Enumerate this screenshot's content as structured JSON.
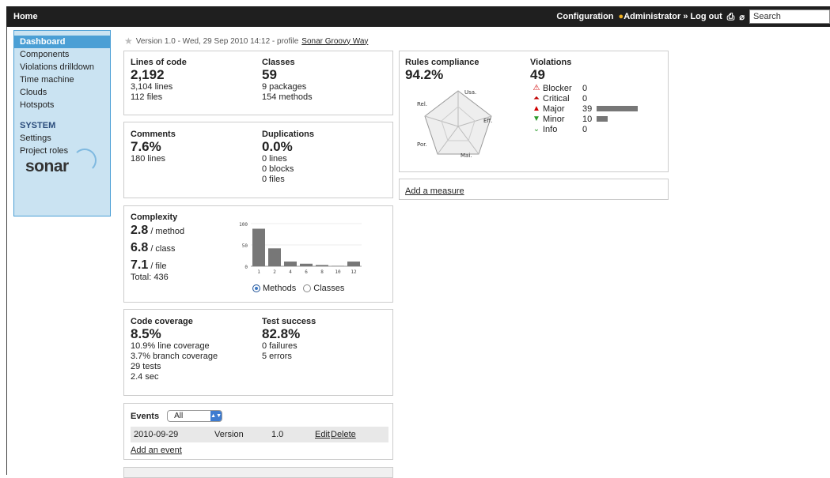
{
  "topbar": {
    "home": "Home",
    "configuration": "Configuration",
    "user": "Administrator",
    "separator": "»",
    "logout": "Log out",
    "search_value": "Search"
  },
  "sidebar": {
    "items": [
      "Dashboard",
      "Components",
      "Violations drilldown",
      "Time machine",
      "Clouds",
      "Hotspots"
    ],
    "system_header": "SYSTEM",
    "system_items": [
      "Settings",
      "Project roles"
    ],
    "logo": "sonar"
  },
  "version": {
    "text": "Version 1.0 - Wed, 29 Sep 2010 14:12 - profile",
    "profile": "Sonar Groovy Way"
  },
  "lines": {
    "label": "Lines of code",
    "value": "2,192",
    "lines": "3,104 lines",
    "files": "112 files"
  },
  "classes": {
    "label": "Classes",
    "value": "59",
    "packages": "9 packages",
    "methods": "154 methods"
  },
  "comments": {
    "label": "Comments",
    "value": "7.6%",
    "lines": "180 lines"
  },
  "duplications": {
    "label": "Duplications",
    "value": "0.0%",
    "lines": "0 lines",
    "blocks": "0 blocks",
    "files": "0 files"
  },
  "complexity": {
    "label": "Complexity",
    "method_value": "2.8",
    "method_unit": "/ method",
    "class_value": "6.8",
    "class_unit": "/ class",
    "file_value": "7.1",
    "file_unit": "/ file",
    "total": "Total: 436",
    "radio_methods": "Methods",
    "radio_classes": "Classes"
  },
  "chart_data": {
    "type": "bar",
    "categories": [
      "1",
      "2",
      "4",
      "6",
      "8",
      "10",
      "12"
    ],
    "values": [
      88,
      42,
      11,
      6,
      3,
      1,
      11
    ],
    "ylim": [
      0,
      100
    ],
    "yticks": [
      "0",
      "50",
      "100"
    ]
  },
  "coverage": {
    "label": "Code coverage",
    "value": "8.5%",
    "line": "10.9% line coverage",
    "branch": "3.7% branch coverage",
    "tests": "29 tests",
    "time": "2.4 sec"
  },
  "success": {
    "label": "Test success",
    "value": "82.8%",
    "failures": "0 failures",
    "errors": "5 errors"
  },
  "events": {
    "label": "Events",
    "filter": "All",
    "row": {
      "date": "2010-09-29",
      "category": "Version",
      "name": "1.0",
      "edit": "Edit",
      "delete": "Delete"
    },
    "add": "Add an event"
  },
  "rules": {
    "label": "Rules compliance",
    "value": "94.2%",
    "radar": [
      "Usa.",
      "Eff.",
      "Mai.",
      "Por.",
      "Rel."
    ]
  },
  "violations": {
    "label": "Violations",
    "value": "49",
    "items": [
      {
        "name": "Blocker",
        "count": "0",
        "fraction": 0,
        "color": "#d00000"
      },
      {
        "name": "Critical",
        "count": "0",
        "fraction": 0,
        "color": "#c00000"
      },
      {
        "name": "Major",
        "count": "39",
        "fraction": 1.0,
        "color": "#d00000"
      },
      {
        "name": "Minor",
        "count": "10",
        "fraction": 0.26,
        "color": "#2a9a2a"
      },
      {
        "name": "Info",
        "count": "0",
        "fraction": 0,
        "color": "#2a9a2a"
      }
    ]
  },
  "measure": {
    "add": "Add a measure"
  }
}
